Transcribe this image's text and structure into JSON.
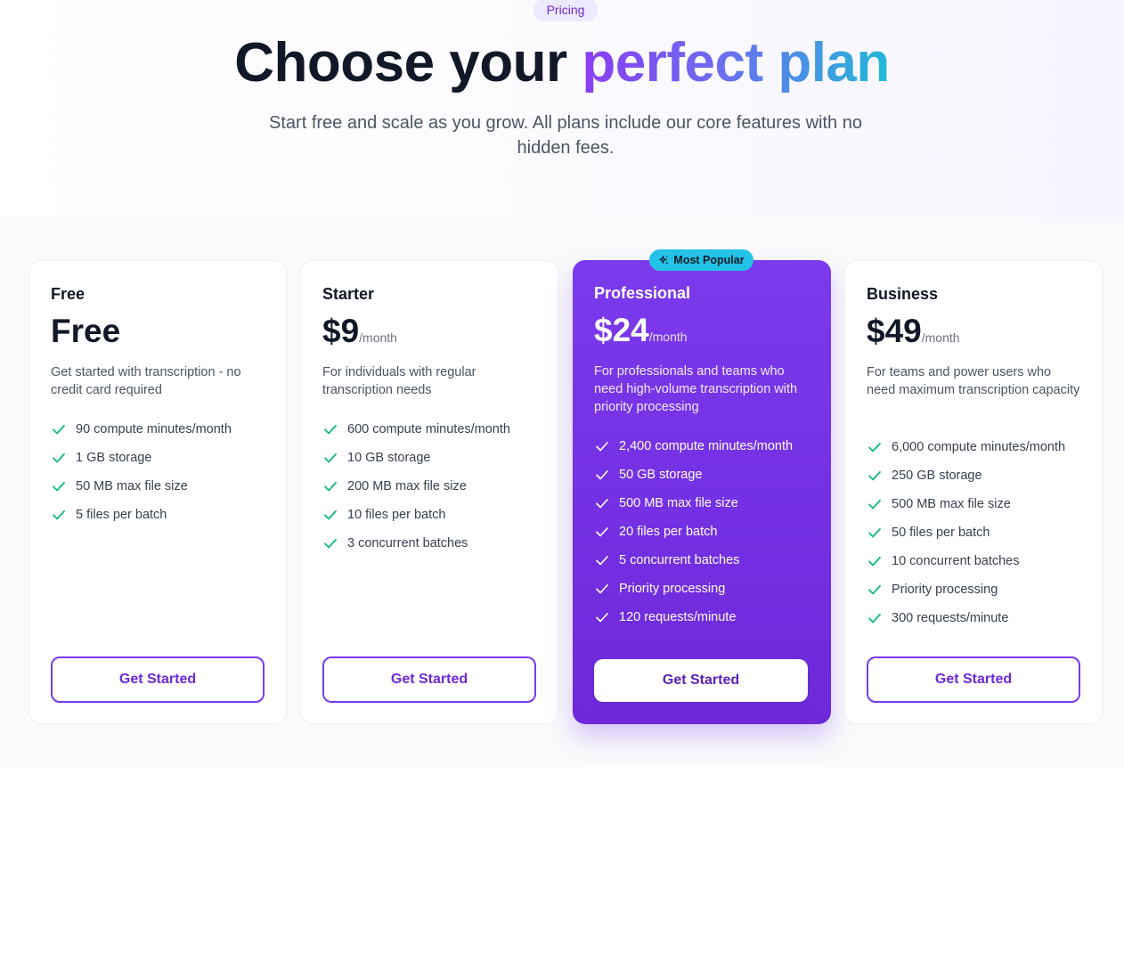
{
  "hero": {
    "badge": "Pricing",
    "title_prefix": "Choose your ",
    "title_highlight": "perfect plan",
    "subtitle": "Start free and scale as you grow. All plans include our core features with no hidden fees."
  },
  "colors": {
    "accent": "#7c3aed",
    "check": "#10b981",
    "popular_badge": "#22c3e6"
  },
  "plans": [
    {
      "name": "Free",
      "price": "Free",
      "period": "",
      "description": "Get started with transcription - no credit card required",
      "features": [
        "90 compute minutes/month",
        "1 GB storage",
        "50 MB max file size",
        "5 files per batch"
      ],
      "cta": "Get Started"
    },
    {
      "name": "Starter",
      "price": "$9",
      "period": "/month",
      "description": "For individuals with regular transcription needs",
      "features": [
        "600 compute minutes/month",
        "10 GB storage",
        "200 MB max file size",
        "10 files per batch",
        "3 concurrent batches"
      ],
      "cta": "Get Started"
    },
    {
      "name": "Professional",
      "price": "$24",
      "period": "/month",
      "badge": "Most Popular",
      "badge_icon": "sparkles-icon",
      "description": "For professionals and teams who need high-volume transcription with priority processing",
      "features": [
        "2,400 compute minutes/month",
        "50 GB storage",
        "500 MB max file size",
        "20 files per batch",
        "5 concurrent batches",
        "Priority processing",
        "120 requests/minute"
      ],
      "cta": "Get Started"
    },
    {
      "name": "Business",
      "price": "$49",
      "period": "/month",
      "description": "For teams and power users who need maximum transcription capacity",
      "features": [
        "6,000 compute minutes/month",
        "250 GB storage",
        "500 MB max file size",
        "50 files per batch",
        "10 concurrent batches",
        "Priority processing",
        "300 requests/minute"
      ],
      "cta": "Get Started"
    }
  ]
}
